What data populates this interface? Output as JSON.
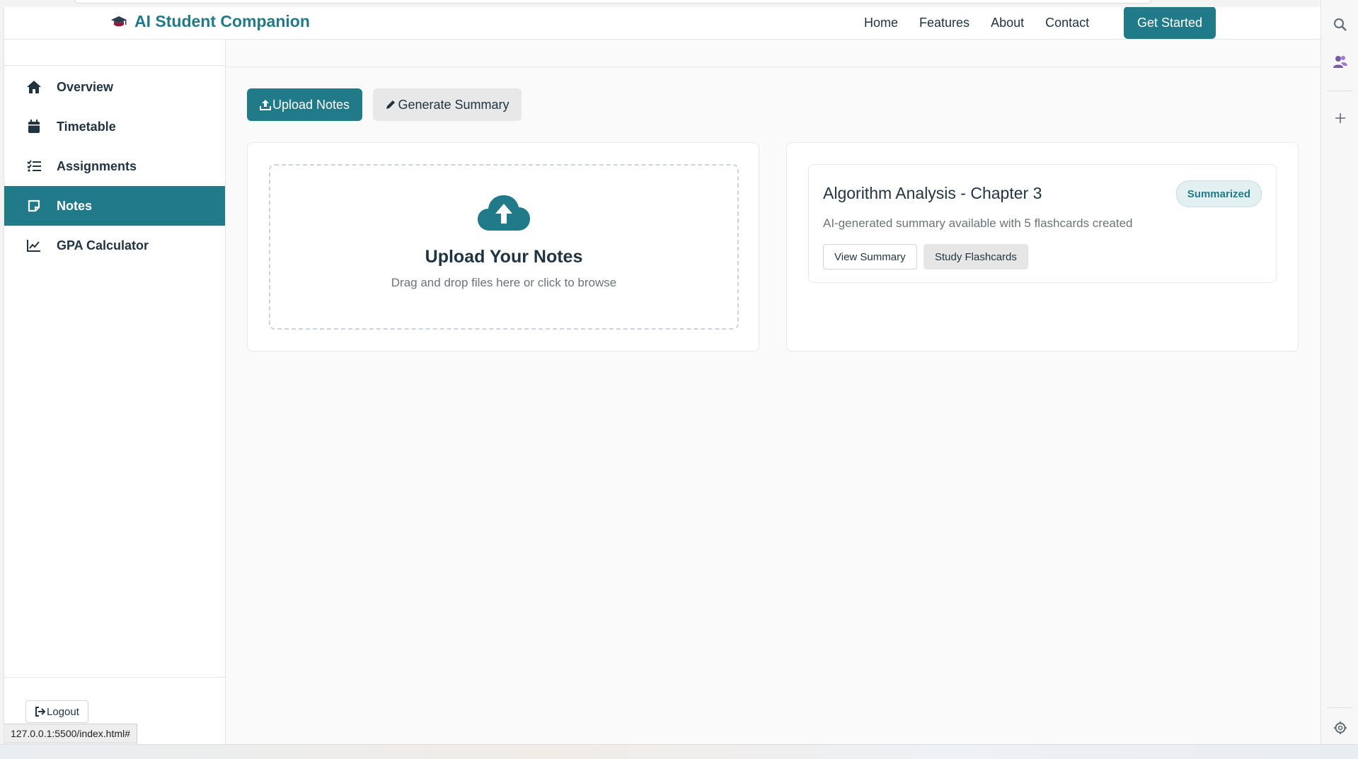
{
  "header": {
    "brand": "AI Student Companion",
    "nav": [
      "Home",
      "Features",
      "About",
      "Contact"
    ],
    "cta": "Get Started"
  },
  "sidebar": {
    "items": [
      {
        "label": "Overview",
        "icon": "home-icon"
      },
      {
        "label": "Timetable",
        "icon": "calendar-icon"
      },
      {
        "label": "Assignments",
        "icon": "list-check-icon"
      },
      {
        "label": "Notes",
        "icon": "note-icon",
        "active": true
      },
      {
        "label": "GPA Calculator",
        "icon": "chart-line-icon"
      }
    ],
    "logout": "Logout"
  },
  "main": {
    "upload_button": "Upload Notes",
    "generate_button": "Generate Summary",
    "dropzone": {
      "title": "Upload Your Notes",
      "subtitle": "Drag and drop files here or click to browse"
    },
    "note": {
      "title": "Algorithm Analysis - Chapter 3",
      "badge": "Summarized",
      "description": "AI-generated summary available with 5 flashcards created",
      "view_button": "View Summary",
      "study_button": "Study Flashcards"
    }
  },
  "status_bar": {
    "url": "127.0.0.1:5500/index.html#"
  },
  "colors": {
    "accent": "#217a88",
    "text": "#1f3440",
    "muted": "#6a7479"
  }
}
